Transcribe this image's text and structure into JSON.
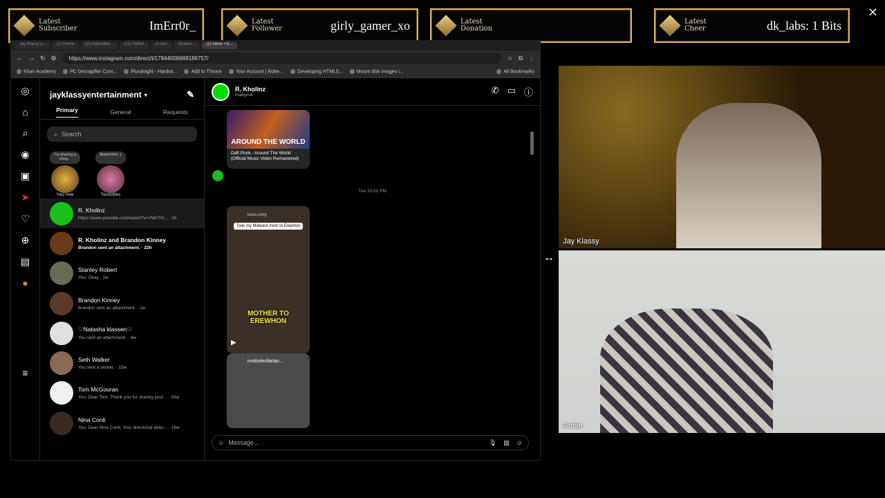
{
  "overlay": {
    "alerts": [
      {
        "label": "Latest Subscriber",
        "value": "ImErr0r_"
      },
      {
        "label": "Latest Follower",
        "value": "girly_gamer_xo"
      },
      {
        "label": "Latest Donation",
        "value": ""
      },
      {
        "label": "Latest Cheer",
        "value": "dk_labs: 1 Bits"
      }
    ],
    "close": "✕"
  },
  "browser": {
    "url": "https://www.instagram.com/direct/t/17844006669186757/",
    "tabs": [
      "Jay Klassy's...",
      "(1) Home",
      "(21) Mywallet...",
      "(21) Twitch",
      "X.com",
      "Stream...",
      "(1) Inbox • D..."
    ],
    "bookmarks": [
      "Khan Academy",
      "PC Decrapifier Com...",
      "Pluralsight - Hardco...",
      "Add to Throne",
      "Your Account | Robe...",
      "Developing HTML5...",
      "Mount disk images i..."
    ],
    "all_bookmarks": "All Bookmarks"
  },
  "inbox": {
    "account": "jayklassyentertainment",
    "tabs": [
      "Primary",
      "General",
      "Requests"
    ],
    "search_placeholder": "Search",
    "notes": [
      {
        "bubble": "Try sharing a song...",
        "name": "Your note"
      },
      {
        "bubble": "Blahhhhhh :)",
        "name": "Twooottles"
      }
    ],
    "conversations": [
      {
        "name": "R. Kholinz",
        "preview": "https://www.youtube.com/watch?v=VWrTrV... · 1h",
        "color": "#19c019"
      },
      {
        "name": "R. Kholinz and Brandon Kinney",
        "preview": "Brandon sent an attachment. · 22h",
        "color": "#6a3a1a"
      },
      {
        "name": "Stanley Robert",
        "preview": "You: Okay · 1w",
        "color": "#6b6b55"
      },
      {
        "name": "Brandon Kinney",
        "preview": "Brandon sent an attachment. · 1w",
        "color": "#5a3a2a"
      },
      {
        "name": "♡Natasha klassen♡",
        "preview": "You sent an attachment. · 4w",
        "color": "#e0e0e0"
      },
      {
        "name": "Seth Walker",
        "preview": "You sent a sticker. · 15w",
        "color": "#8a6a55"
      },
      {
        "name": "Tom McGouran",
        "preview": "You: Dear Tom, Thank you for sharing your... · 15w",
        "color": "#f0f0f0"
      },
      {
        "name": "Nina Conti",
        "preview": "You: Dear Nina Conti, Your directorial debu... · 16w",
        "color": "#3a2a20"
      }
    ]
  },
  "thread": {
    "name": "R. Kholinz",
    "username": "rhabyrne",
    "card1_title": "Daft Punk - Around The World (Official Music Video Remastered)",
    "card1_art": "AROUND THE WORLD",
    "timestamp": "Tue 10:01 PM",
    "card2_user": "laura.clery",
    "card2_caption": "Took my Midwest mom to Erewhon",
    "card2_overlay": "MOTHER TO EREWHON",
    "card3_user": "instituteofartan...",
    "message_placeholder": "Message..."
  },
  "cams": [
    {
      "name": "Jay Klassy"
    },
    {
      "name": "Robin"
    }
  ]
}
